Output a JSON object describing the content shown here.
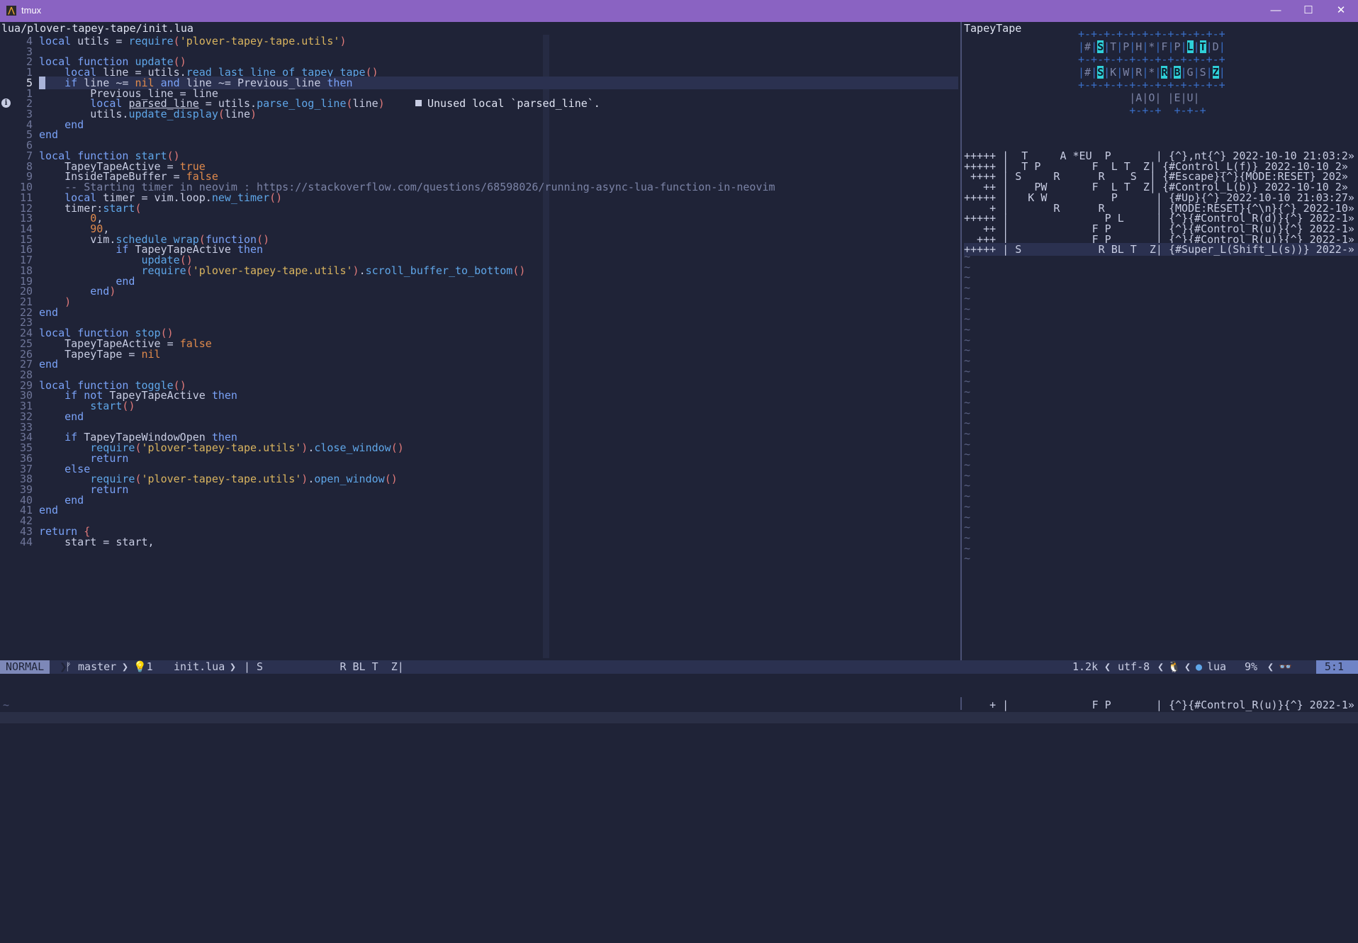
{
  "window": {
    "title": "tmux",
    "minimize": "—",
    "maximize": "☐",
    "close": "✕"
  },
  "editor": {
    "file_path": "lua/plover-tapey-tape/init.lua",
    "diagnostic": "Unused local `parsed_line`.",
    "lines": [
      {
        "n": "4",
        "t": "local utils = require('plover-tapey-tape.utils')"
      },
      {
        "n": "3",
        "t": ""
      },
      {
        "n": "2",
        "t": "local function update()"
      },
      {
        "n": "1",
        "t": "    local line = utils.read_last_line_of_tapey_tape()"
      },
      {
        "n": "5",
        "t": "    if line ~= nil and line ~= Previous_line then"
      },
      {
        "n": "1",
        "t": "        Previous_line = line"
      },
      {
        "n": "2",
        "t": "        local parsed_line = utils.parse_log_line(line)"
      },
      {
        "n": "3",
        "t": "        utils.update_display(line)"
      },
      {
        "n": "4",
        "t": "    end"
      },
      {
        "n": "5",
        "t": "end"
      },
      {
        "n": "6",
        "t": ""
      },
      {
        "n": "7",
        "t": "local function start()"
      },
      {
        "n": "8",
        "t": "    TapeyTapeActive = true"
      },
      {
        "n": "9",
        "t": "    InsideTapeBuffer = false"
      },
      {
        "n": "10",
        "t": "    -- Starting timer in neovim : https://stackoverflow.com/questions/68598026/running-async-lua-function-in-neovim"
      },
      {
        "n": "11",
        "t": "    local timer = vim.loop.new_timer()"
      },
      {
        "n": "12",
        "t": "    timer:start("
      },
      {
        "n": "13",
        "t": "        0,"
      },
      {
        "n": "14",
        "t": "        90,"
      },
      {
        "n": "15",
        "t": "        vim.schedule_wrap(function()"
      },
      {
        "n": "16",
        "t": "            if TapeyTapeActive then"
      },
      {
        "n": "17",
        "t": "                update()"
      },
      {
        "n": "18",
        "t": "                require('plover-tapey-tape.utils').scroll_buffer_to_bottom()"
      },
      {
        "n": "19",
        "t": "            end"
      },
      {
        "n": "20",
        "t": "        end)"
      },
      {
        "n": "21",
        "t": "    )"
      },
      {
        "n": "22",
        "t": "end"
      },
      {
        "n": "23",
        "t": ""
      },
      {
        "n": "24",
        "t": "local function stop()"
      },
      {
        "n": "25",
        "t": "    TapeyTapeActive = false"
      },
      {
        "n": "26",
        "t": "    TapeyTape = nil"
      },
      {
        "n": "27",
        "t": "end"
      },
      {
        "n": "28",
        "t": ""
      },
      {
        "n": "29",
        "t": "local function toggle()"
      },
      {
        "n": "30",
        "t": "    if not TapeyTapeActive then"
      },
      {
        "n": "31",
        "t": "        start()"
      },
      {
        "n": "32",
        "t": "    end"
      },
      {
        "n": "33",
        "t": ""
      },
      {
        "n": "34",
        "t": "    if TapeyTapeWindowOpen then"
      },
      {
        "n": "35",
        "t": "        require('plover-tapey-tape.utils').close_window()"
      },
      {
        "n": "36",
        "t": "        return"
      },
      {
        "n": "37",
        "t": "    else"
      },
      {
        "n": "38",
        "t": "        require('plover-tapey-tape.utils').open_window()"
      },
      {
        "n": "39",
        "t": "        return"
      },
      {
        "n": "40",
        "t": "    end"
      },
      {
        "n": "41",
        "t": "end"
      },
      {
        "n": "42",
        "t": ""
      },
      {
        "n": "43",
        "t": "return {"
      },
      {
        "n": "44",
        "t": "    start = start,"
      }
    ]
  },
  "tape": {
    "title": "TapeyTape",
    "steno": {
      "border": "+-+-+-+-+-+-+-+-+-+-+-+",
      "row1": [
        "#",
        "S",
        "T",
        "P",
        "H",
        "*",
        "F",
        "P",
        "L",
        "T",
        "D"
      ],
      "row2": [
        "#",
        "S",
        "K",
        "W",
        "R",
        "*",
        "R",
        "B",
        "G",
        "S",
        "Z"
      ],
      "vowel_border": "+-+-+  +-+-+",
      "vowels": "|A|O| |E|U|"
    },
    "entries": [
      "+++++ |  T     A *EU  P       | {^},nt{^} 2022-10-10 21:03:2»",
      "+++++ |  T P        F  L T  Z| {#Control_L(f)} 2022-10-10 2»",
      " ++++ | S     R      R    S  | {#Escape}{^}{MODE:RESET} 202»",
      "   ++ |    PW       F  L T  Z| {#Control_L(b)} 2022-10-10 2»",
      "+++++ |   K W          P      | {#Up}{^} 2022-10-10 21:03:27»",
      "    + |       R      R        | {MODE:RESET}{^\\n}{^} 2022-10»",
      "+++++ |               P L     | {^}{#Control_R(d)}{^} 2022-1»",
      "   ++ |             F P       | {^}{#Control_R(u)}{^} 2022-1»",
      "  +++ |             F P       | {^}{#Control_R(u)}{^} 2022-1»",
      "+++++ | S            R BL T  Z| {#Super_L(Shift_L(s))} 2022-»"
    ],
    "tilde": "~",
    "bottom_entry": "    + |             F P       | {^}{#Control_R(u)}{^} 2022-1»"
  },
  "statusbar": {
    "mode": "NORMAL",
    "branch": "ᚠ master",
    "diag_count": "💡1",
    "filename": "init.lua",
    "stroke": "| S            R BL T  Z|",
    "size": "1.2k",
    "encoding": "utf-8",
    "os_icon": "🐧",
    "filetype": "lua",
    "percent": "9%",
    "position": "5:1"
  },
  "colors": {
    "bg": "#1f2337",
    "titlebar": "#8a63c2",
    "highlight": "#2fd0d8"
  }
}
